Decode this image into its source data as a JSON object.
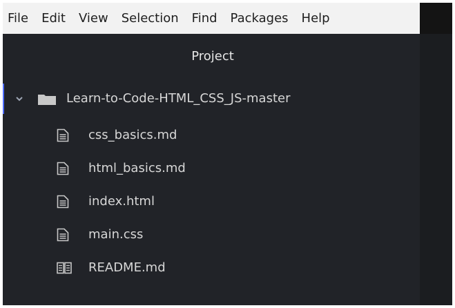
{
  "menubar": {
    "items": [
      "File",
      "Edit",
      "View",
      "Selection",
      "Find",
      "Packages",
      "Help"
    ]
  },
  "panel": {
    "title": "Project",
    "root": {
      "label": "Learn-to-Code-HTML_CSS_JS-master",
      "icon": "folder-icon",
      "expanded": true
    },
    "files": [
      {
        "label": "css_basics.md",
        "icon": "file-text-icon"
      },
      {
        "label": "html_basics.md",
        "icon": "file-text-icon"
      },
      {
        "label": "index.html",
        "icon": "file-text-icon"
      },
      {
        "label": "main.css",
        "icon": "file-text-icon"
      },
      {
        "label": "README.md",
        "icon": "book-icon"
      }
    ]
  },
  "colors": {
    "menubar_bg": "#f2f2f2",
    "panel_bg": "#212328",
    "text": "#d7d7d7",
    "selection_accent": "#4d6bff"
  }
}
